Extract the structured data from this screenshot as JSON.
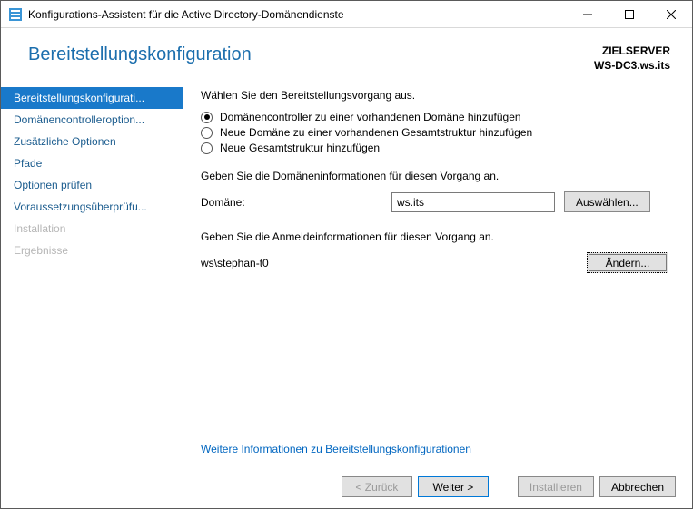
{
  "window": {
    "title": "Konfigurations-Assistent für die Active Directory-Domänendienste"
  },
  "header": {
    "heading": "Bereitstellungskonfiguration",
    "target_label": "ZIELSERVER",
    "target_server": "WS-DC3.ws.its"
  },
  "sidebar": {
    "items": [
      "Bereitstellungskonfigurati...",
      "Domänencontrolleroption...",
      "Zusätzliche Optionen",
      "Pfade",
      "Optionen prüfen",
      "Voraussetzungsüberprüfu...",
      "Installation",
      "Ergebnisse"
    ]
  },
  "content": {
    "select_op_label": "Wählen Sie den Bereitstellungsvorgang aus.",
    "radios": [
      "Domänencontroller zu einer vorhandenen Domäne hinzufügen",
      "Neue Domäne zu einer vorhandenen Gesamtstruktur hinzufügen",
      "Neue Gesamtstruktur hinzufügen"
    ],
    "domain_info_label": "Geben Sie die Domäneninformationen für diesen Vorgang an.",
    "domain_label": "Domäne:",
    "domain_value": "ws.its",
    "select_button": "Auswählen...",
    "cred_info_label": "Geben Sie die Anmeldeinformationen für diesen Vorgang an.",
    "cred_value": "ws\\stephan-t0",
    "change_button": "Ändern...",
    "more_link": "Weitere Informationen zu Bereitstellungskonfigurationen"
  },
  "footer": {
    "back": "< Zurück",
    "next": "Weiter >",
    "install": "Installieren",
    "cancel": "Abbrechen"
  }
}
